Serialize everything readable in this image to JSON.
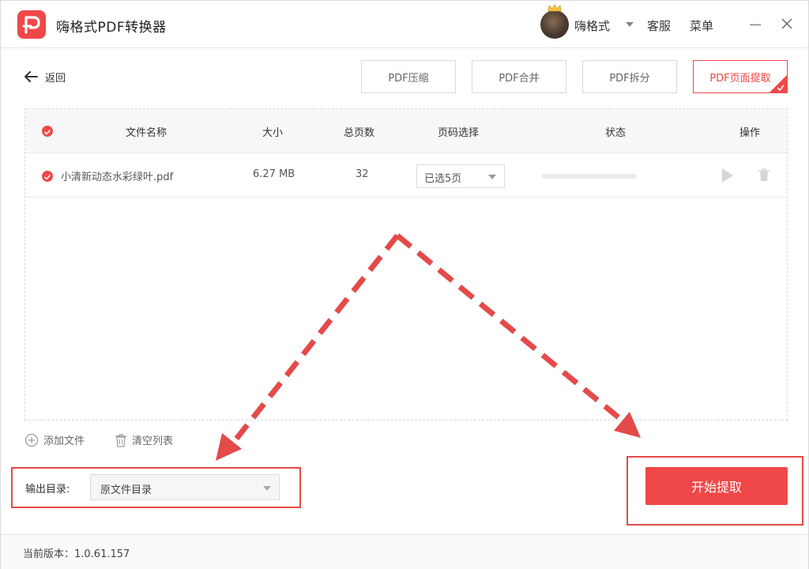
{
  "app": {
    "title": "嗨格式PDF转换器",
    "brand_color": "#f04848",
    "logo_icon": "app-logo-icon"
  },
  "header": {
    "username": "嗨格式",
    "service": "客服",
    "menu": "菜单"
  },
  "toolbar": {
    "back_label": "返回",
    "tools": [
      {
        "label": "PDF压缩",
        "active": false
      },
      {
        "label": "PDF合并",
        "active": false
      },
      {
        "label": "PDF拆分",
        "active": false
      },
      {
        "label": "PDF页面提取",
        "active": true
      }
    ]
  },
  "table": {
    "columns": [
      "文件名称",
      "大小",
      "总页数",
      "页码选择",
      "状态",
      "操作"
    ],
    "rows": [
      {
        "checked": true,
        "filename": "小清新动态水彩绿叶.pdf",
        "size": "6.27 MB",
        "pages": "32",
        "page_selection": "已选5页",
        "progress": 0
      }
    ]
  },
  "actions": {
    "add_file": "添加文件",
    "clear_list": "清空列表"
  },
  "output": {
    "label": "输出目录:",
    "value": "原文件目录"
  },
  "start_button": "开始提取",
  "footer": {
    "version": "当前版本：1.0.61.157"
  },
  "annotation_color": "#e54a4a"
}
